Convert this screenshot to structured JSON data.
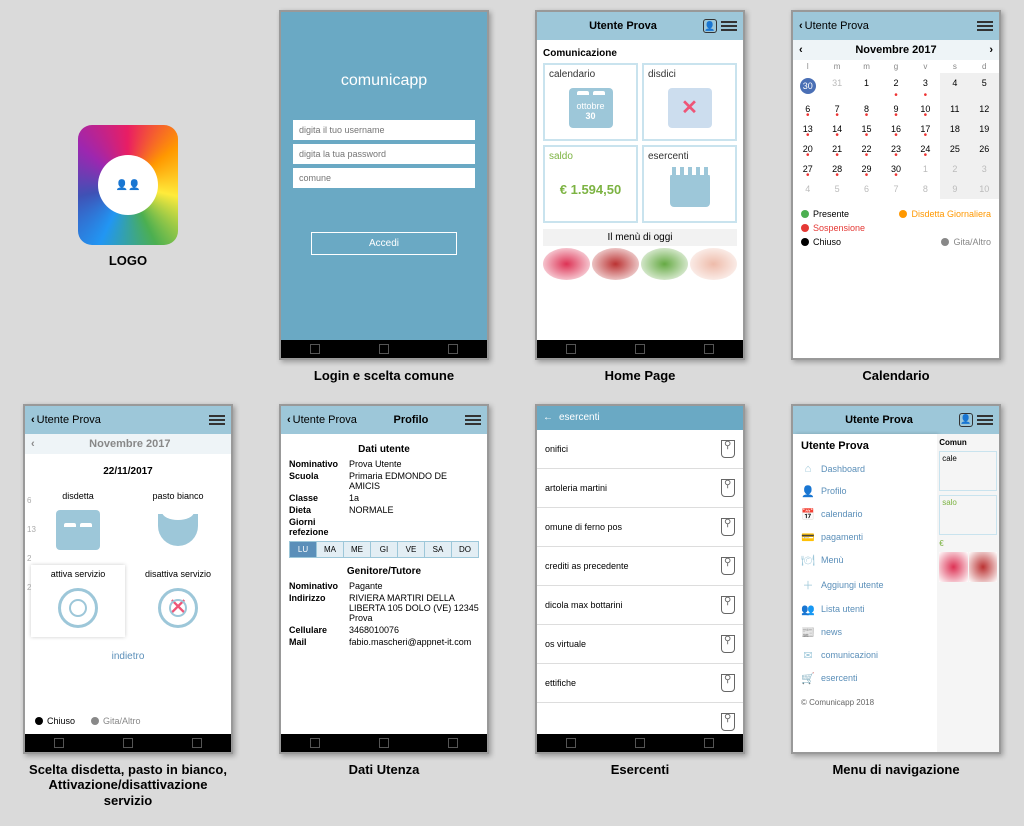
{
  "captions": {
    "logo": "LOGO",
    "login": "Login e scelta comune",
    "home": "Home Page",
    "calendar": "Calendario",
    "scelta": "Scelta disdetta, pasto in bianco, Attivazione/disattivazione servizio",
    "dati": "Dati Utenza",
    "esercenti": "Esercenti",
    "menu": "Menu di navigazione"
  },
  "login": {
    "brand": "comunicapp",
    "username_ph": "digita il tuo username",
    "password_ph": "digita la tua password",
    "comune_ph": "comune",
    "accedi": "Accedi"
  },
  "home": {
    "top_user": "Utente Prova",
    "comunicazione": "Comunicazione",
    "calendario": "calendario",
    "cal_month": "ottobre",
    "cal_day": "30",
    "disdici": "disdici",
    "saldo_lbl": "saldo",
    "saldo_val": "€ 1.594,50",
    "esercenti": "esercenti",
    "menu_oggi": "Il menù di oggi"
  },
  "calendar": {
    "top_user": "Utente Prova",
    "month": "Novembre 2017",
    "dow": [
      "l",
      "m",
      "m",
      "g",
      "v",
      "s",
      "d"
    ],
    "rows": [
      [
        {
          "n": "30",
          "sel": true,
          "other": true
        },
        {
          "n": "31",
          "other": true
        },
        {
          "n": "1"
        },
        {
          "n": "2",
          "dot": true
        },
        {
          "n": "3",
          "dot": true
        },
        {
          "n": "4",
          "wk": true
        },
        {
          "n": "5",
          "wk": true
        }
      ],
      [
        {
          "n": "6",
          "dot": true
        },
        {
          "n": "7",
          "dot": true
        },
        {
          "n": "8",
          "dot": true
        },
        {
          "n": "9",
          "dot": true
        },
        {
          "n": "10",
          "dot": true
        },
        {
          "n": "11",
          "wk": true
        },
        {
          "n": "12",
          "wk": true
        }
      ],
      [
        {
          "n": "13",
          "dot": true
        },
        {
          "n": "14",
          "dot": true
        },
        {
          "n": "15",
          "dot": true
        },
        {
          "n": "16",
          "dot": true
        },
        {
          "n": "17",
          "dot": true
        },
        {
          "n": "18",
          "wk": true
        },
        {
          "n": "19",
          "wk": true
        }
      ],
      [
        {
          "n": "20",
          "dot": true
        },
        {
          "n": "21",
          "dot": true
        },
        {
          "n": "22",
          "dot": true
        },
        {
          "n": "23",
          "dot": true
        },
        {
          "n": "24",
          "dot": true
        },
        {
          "n": "25",
          "wk": true
        },
        {
          "n": "26",
          "wk": true
        }
      ],
      [
        {
          "n": "27",
          "dot": true
        },
        {
          "n": "28",
          "dot": true
        },
        {
          "n": "29",
          "dot": true
        },
        {
          "n": "30",
          "dot": true
        },
        {
          "n": "1",
          "other": true
        },
        {
          "n": "2",
          "other": true,
          "wk": true
        },
        {
          "n": "3",
          "other": true,
          "wk": true
        }
      ],
      [
        {
          "n": "4",
          "other": true
        },
        {
          "n": "5",
          "other": true
        },
        {
          "n": "6",
          "other": true
        },
        {
          "n": "7",
          "other": true
        },
        {
          "n": "8",
          "other": true
        },
        {
          "n": "9",
          "other": true,
          "wk": true
        },
        {
          "n": "10",
          "other": true,
          "wk": true
        }
      ]
    ],
    "legend": {
      "presente": "Presente",
      "disdetta": "Disdetta Giornaliera",
      "sospensione": "Sospensione",
      "chiuso": "Chiuso",
      "gita": "Gita/Altro"
    }
  },
  "scelta": {
    "top_user": "Utente Prova",
    "month": "Novembre 2017",
    "date": "22/11/2017",
    "disdetta": "disdetta",
    "pasto": "pasto bianco",
    "attiva": "attiva servizio",
    "disattiva": "disattiva servizio",
    "indietro": "indietro",
    "chiuso": "Chiuso",
    "gita": "Gita/Altro"
  },
  "dati": {
    "top_user": "Utente Prova",
    "profilo": "Profilo",
    "dati_utente": "Dati utente",
    "nominativo_l": "Nominativo",
    "nominativo_v": "Prova Utente",
    "scuola_l": "Scuola",
    "scuola_v": "Primaria EDMONDO DE AMICIS",
    "classe_l": "Classe",
    "classe_v": "1a",
    "dieta_l": "Dieta",
    "dieta_v": "NORMALE",
    "giorni_l": "Giorni refezione",
    "days": [
      "LU",
      "MA",
      "ME",
      "GI",
      "VE",
      "SA",
      "DO"
    ],
    "genitore": "Genitore/Tutore",
    "gnom_l": "Nominativo",
    "gnom_v": "Pagante",
    "gind_l": "Indirizzo",
    "gind_v": "RIVIERA MARTIRI DELLA LIBERTA  105 DOLO (VE) 12345 Prova",
    "gcell_l": "Cellulare",
    "gcell_v": "3468010076",
    "gmail_l": "Mail",
    "gmail_v": "fabio.mascheri@appnet-it.com"
  },
  "esercenti": {
    "title": "esercenti",
    "items": [
      "onifici",
      "artoleria martini",
      "omune di ferno pos",
      "crediti as precedente",
      "dicola max bottarini",
      "os virtuale",
      "ettifiche",
      ""
    ]
  },
  "menu": {
    "top_user": "Utente Prova",
    "drawer_user": "Utente Prova",
    "items": [
      {
        "icon": "⌂",
        "label": "Dashboard"
      },
      {
        "icon": "👤",
        "label": "Profilo"
      },
      {
        "icon": "📅",
        "label": "calendario"
      },
      {
        "icon": "💳",
        "label": "pagamenti"
      },
      {
        "icon": "🍽",
        "label": "Menù"
      },
      {
        "icon": "＋",
        "label": "Aggiungi utente"
      },
      {
        "icon": "👥",
        "label": "Lista utenti"
      },
      {
        "icon": "📰",
        "label": "news"
      },
      {
        "icon": "✉",
        "label": "comunicazioni"
      },
      {
        "icon": "🛒",
        "label": "esercenti"
      }
    ],
    "copy": "© Comunicapp 2018",
    "back": {
      "comun": "Comun",
      "cale": "cale",
      "salo": "salo",
      "euro": "€"
    }
  }
}
